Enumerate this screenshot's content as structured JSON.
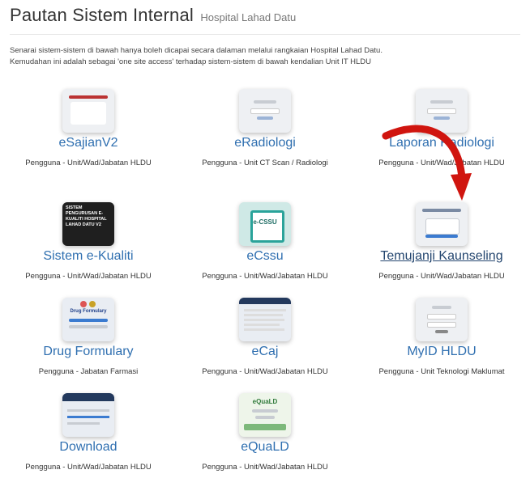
{
  "header": {
    "title": "Pautan Sistem Internal",
    "subtitle": "Hospital Lahad Datu"
  },
  "intro": {
    "line1": "Senarai sistem-sistem di bawah hanya boleh dicapai secara dalaman melalui rangkaian Hospital Lahad Datu.",
    "line2": "Kemudahan ini adalah sebagai 'one site access' terhadap sistem-sistem di bawah kendalian Unit IT HLDU"
  },
  "systems": [
    {
      "name": "eSajianV2",
      "users": "Pengguna - Unit/Wad/Jabatan HLDU",
      "icon": "esajian-thumbnail-icon"
    },
    {
      "name": "eRadiologi",
      "users": "Pengguna - Unit CT Scan / Radiologi",
      "icon": "eradiologi-thumbnail-icon"
    },
    {
      "name": "Laporan Radiologi",
      "users": "Pengguna - Unit/Wad/Jabatan HLDU",
      "icon": "laporan-radiologi-thumbnail-icon"
    },
    {
      "name": "Sistem e-Kualiti",
      "users": "Pengguna - Unit/Wad/Jabatan HLDU",
      "icon": "ekualiti-thumbnail-icon",
      "thumb_text": "SISTEM PENGURUSAN E-KUALITI HOSPITAL LAHAD DATU V2"
    },
    {
      "name": "eCssu",
      "users": "Pengguna - Unit/Wad/Jabatan HLDU",
      "icon": "ecssu-thumbnail-icon",
      "thumb_text": "e-CSSU"
    },
    {
      "name": "Temujanji Kaunseling",
      "users": "Pengguna - Unit/Wad/Jabatan HLDU",
      "icon": "temujanji-thumbnail-icon"
    },
    {
      "name": "Drug Formulary",
      "users": "Pengguna - Jabatan Farmasi",
      "icon": "drug-formulary-thumbnail-icon",
      "thumb_text": "Drug Formulary"
    },
    {
      "name": "eCaj",
      "users": "Pengguna - Unit/Wad/Jabatan HLDU",
      "icon": "ecaj-thumbnail-icon"
    },
    {
      "name": "MyID HLDU",
      "users": "Pengguna - Unit Teknologi Maklumat",
      "icon": "myid-thumbnail-icon"
    },
    {
      "name": "Download",
      "users": "Pengguna - Unit/Wad/Jabatan HLDU",
      "icon": "download-thumbnail-icon"
    },
    {
      "name": "eQuaLD",
      "users": "Pengguna - Unit/Wad/Jabatan HLDU",
      "icon": "equald-thumbnail-icon",
      "thumb_text": "eQuaLD"
    }
  ],
  "colors": {
    "link": "#2f6fb0",
    "link_hover": "#24466f",
    "arrow": "#d0150f"
  }
}
